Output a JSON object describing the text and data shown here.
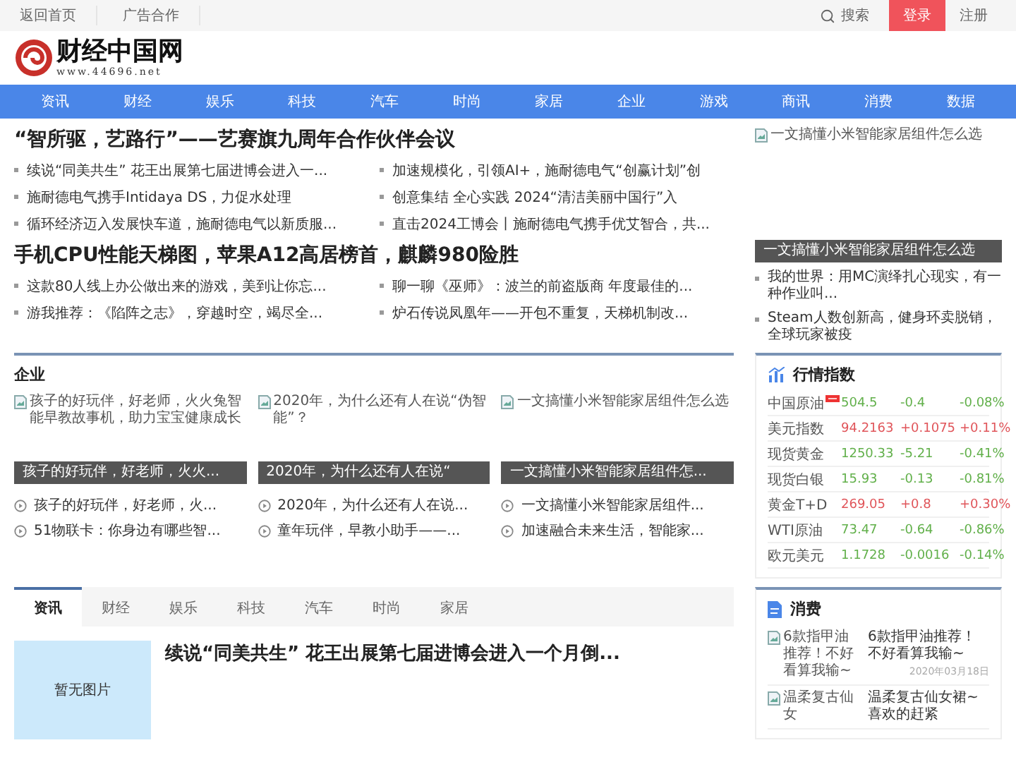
{
  "top_bar": {
    "links": [
      "返回首页",
      "广告合作"
    ],
    "search": "搜索",
    "login": "登录",
    "register": "注册"
  },
  "logo": {
    "name": "财经中国网",
    "url": "www.44696.net"
  },
  "nav": [
    "资讯",
    "财经",
    "娱乐",
    "科技",
    "汽车",
    "时尚",
    "家居",
    "企业",
    "游戏",
    "商讯",
    "消费",
    "数据"
  ],
  "headlines": [
    {
      "title": "“智所驱，艺路行”——艺赛旗九周年合作伙伴会议",
      "items": [
        "续说“同美共生” 花王出展第七届进博会进入一...",
        "加速规模化，引领AI+，施耐德电气“创赢计划”创",
        "施耐德电气携手Intidaya DS，力促水处理",
        "创意集结 全心实践 2024“清洁美丽中国行”入",
        "循环经济迈入发展快车道，施耐德电气以新质服...",
        "直击2024工博会丨施耐德电气携手优艾智合，共..."
      ]
    },
    {
      "title": "手机CPU性能天梯图，苹果A12高居榜首，麒麟980险胜",
      "items": [
        "这款80人线上办公做出来的游戏，美到让你忘...",
        "聊一聊《巫师》：波兰的前盗版商 年度最佳的...",
        "游我推荐：《陷阵之志》，穿越时空，竭尽全...",
        "炉石传说凤凰年——开包不重复，天梯机制改..."
      ]
    }
  ],
  "feature": {
    "image_alt": "一文搞懂小米智能家居组件怎么选",
    "caption": "一文搞懂小米智能家居组件怎么选",
    "items": [
      "我的世界：用MC演绎扎心现实，有一种作业叫...",
      "Steam人数创新高，健身环卖脱销，全球玩家被疫"
    ]
  },
  "enterprise": {
    "title": "企业",
    "cards": [
      {
        "image_alt": "孩子的好玩伴，好老师，火火兔智能早教故事机，助力宝宝健康成长",
        "caption": "孩子的好玩伴，好老师，火火..."
      },
      {
        "image_alt": "2020年，为什么还有人在说“伪智能”？",
        "caption": "2020年，为什么还有人在说“"
      },
      {
        "image_alt": "一文搞懂小米智能家居组件怎么选",
        "caption": "一文搞懂小米智能家居组件怎..."
      }
    ],
    "links": [
      "孩子的好玩伴，好老师，火...",
      "2020年，为什么还有人在说...",
      "一文搞懂小米智能家居组件...",
      "51物联卡：你身边有哪些智...",
      "童年玩伴，早教小助手——...",
      "加速融合未来生活，智能家..."
    ]
  },
  "market": {
    "title": "行情指数",
    "rows": [
      {
        "name": "中国原油",
        "badge": true,
        "value": "504.5",
        "change": "-0.4",
        "percent": "-0.08%",
        "rising": false
      },
      {
        "name": "美元指数",
        "badge": false,
        "value": "94.2163",
        "change": "+0.1075",
        "percent": "+0.11%",
        "rising": true
      },
      {
        "name": "现货黄金",
        "badge": false,
        "value": "1250.33",
        "change": "-5.21",
        "percent": "-0.41%",
        "rising": false
      },
      {
        "name": "现货白银",
        "badge": false,
        "value": "15.93",
        "change": "-0.13",
        "percent": "-0.81%",
        "rising": false
      },
      {
        "name": "黄金T+D",
        "badge": false,
        "value": "269.05",
        "change": "+0.8",
        "percent": "+0.30%",
        "rising": true
      },
      {
        "name": "WTI原油",
        "badge": false,
        "value": "73.47",
        "change": "-0.64",
        "percent": "-0.86%",
        "rising": false
      },
      {
        "name": "欧元美元",
        "badge": false,
        "value": "1.1728",
        "change": "-0.0016",
        "percent": "-0.14%",
        "rising": false
      }
    ]
  },
  "tabs": [
    {
      "label": "资讯",
      "selected": true
    },
    {
      "label": "财经",
      "selected": false
    },
    {
      "label": "娱乐",
      "selected": false
    },
    {
      "label": "科技",
      "selected": false
    },
    {
      "label": "汽车",
      "selected": false
    },
    {
      "label": "时尚",
      "selected": false
    },
    {
      "label": "家居",
      "selected": false
    }
  ],
  "news": {
    "image_placeholder": "暂无图片",
    "title": "续说“同美共生” 花王出展第七届进博会进入一个月倒..."
  },
  "consumer": {
    "title": "消费",
    "items": [
      {
        "image_alt": "6款指甲油推荐！不好看算我输~",
        "title": "6款指甲油推荐！不好看算我输~",
        "date": "2020年03月18日"
      },
      {
        "image_alt": "温柔复古仙女",
        "title": "温柔复古仙女裙~喜欢的赶紧"
      }
    ]
  }
}
